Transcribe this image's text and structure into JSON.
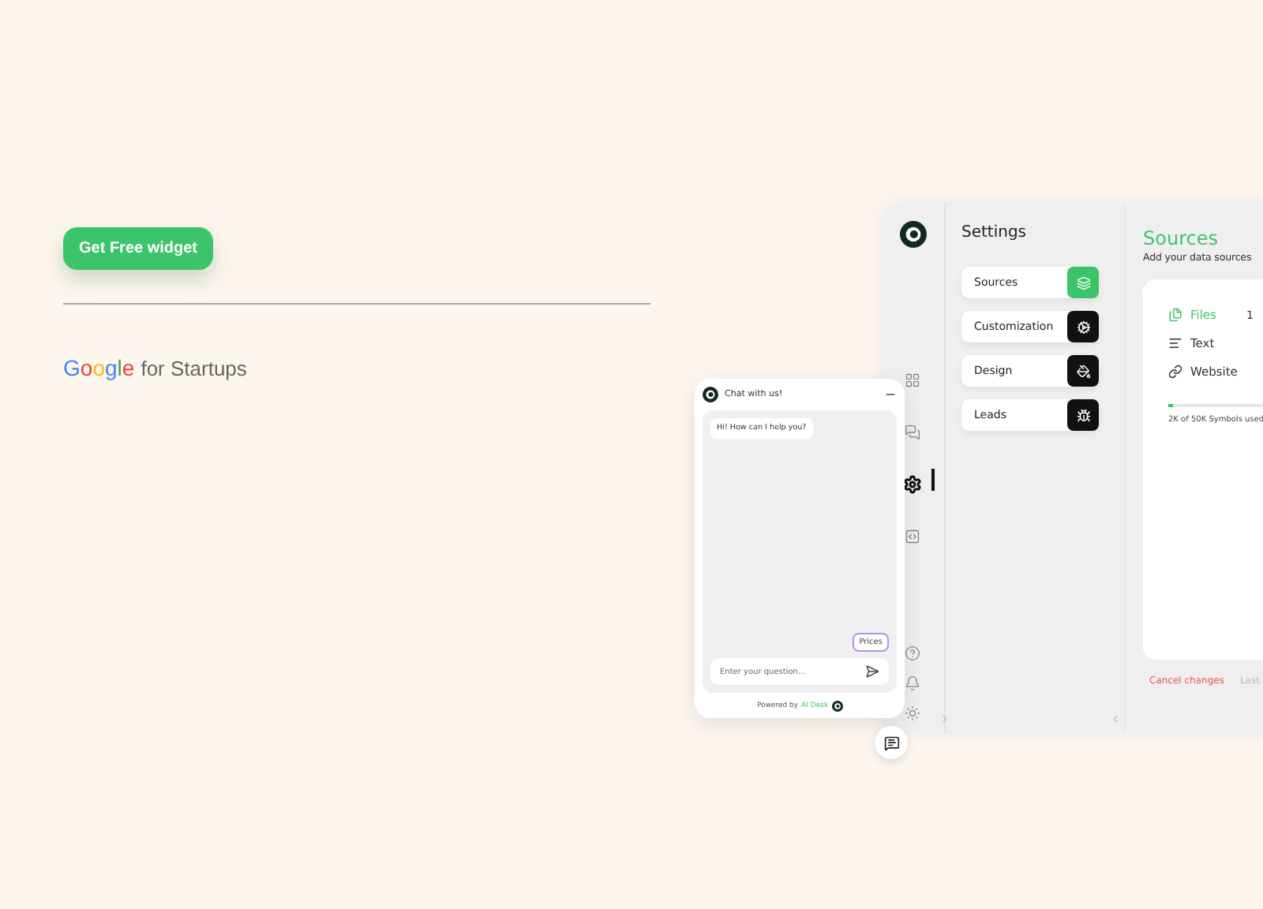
{
  "cta": {
    "label": "Get Free widget"
  },
  "partner": {
    "logo": "Google",
    "text": "for Startups"
  },
  "app": {
    "rail": [
      {
        "kind": "grid",
        "selected": false
      },
      {
        "kind": "chats",
        "selected": false
      },
      {
        "kind": "settings",
        "selected": true
      },
      {
        "kind": "code",
        "selected": false
      },
      {
        "kind": "help",
        "selected": false
      },
      {
        "kind": "bell",
        "selected": false
      },
      {
        "kind": "sun",
        "selected": false
      }
    ],
    "settings_title": "Settings",
    "menu": [
      {
        "label": "Sources",
        "kind": "layers",
        "selected": true
      },
      {
        "label": "Customization",
        "kind": "gear",
        "selected": false
      },
      {
        "label": "Design",
        "kind": "paint",
        "selected": false
      },
      {
        "label": "Leads",
        "kind": "bug",
        "selected": false
      }
    ],
    "section_title": "Sources",
    "section_subtitle": "Add your data sources",
    "source_tabs": [
      {
        "label": "Files",
        "kind": "files",
        "selected": true,
        "count": "1"
      },
      {
        "label": "Text",
        "kind": "text",
        "selected": false
      },
      {
        "label": "Website",
        "kind": "link",
        "selected": false
      }
    ],
    "usage": {
      "level": 0.04,
      "text": "2K of 50K Symbols used"
    },
    "cancel": "Cancel changes",
    "last": "Last"
  },
  "chat": {
    "title": "Chat with us!",
    "greeting": "Hi! How can I help you?",
    "quick_reply": "Prices",
    "placeholder": "Enter your question...",
    "powered_by": "Powered by",
    "brand": "AI Desk"
  }
}
